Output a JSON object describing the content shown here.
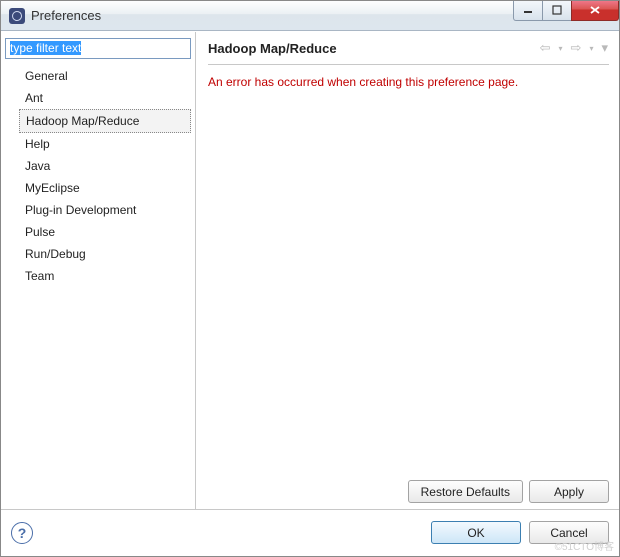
{
  "window": {
    "title": "Preferences"
  },
  "sidebar": {
    "filter_placeholder": "type filter text",
    "items": [
      {
        "label": "General"
      },
      {
        "label": "Ant"
      },
      {
        "label": "Hadoop Map/Reduce",
        "selected": true
      },
      {
        "label": "Help"
      },
      {
        "label": "Java"
      },
      {
        "label": "MyEclipse"
      },
      {
        "label": "Plug-in Development"
      },
      {
        "label": "Pulse"
      },
      {
        "label": "Run/Debug"
      },
      {
        "label": "Team"
      }
    ]
  },
  "content": {
    "title": "Hadoop Map/Reduce",
    "error": "An error has occurred when creating this preference page.",
    "buttons": {
      "restore_defaults": "Restore Defaults",
      "apply": "Apply"
    }
  },
  "footer": {
    "ok": "OK",
    "cancel": "Cancel"
  },
  "watermark": "©51CTO博客"
}
